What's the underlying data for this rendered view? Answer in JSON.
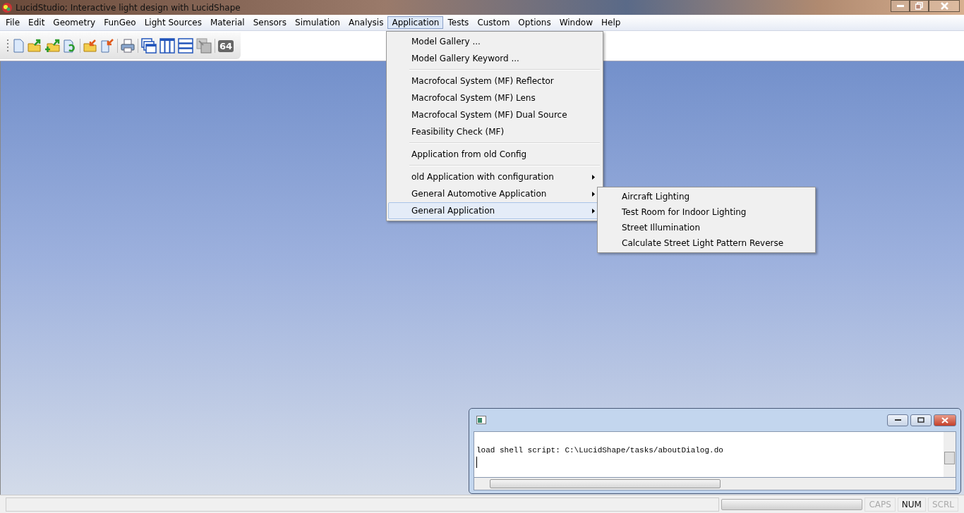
{
  "window": {
    "title": "LucidStudio; Interactive light design with LucidShape"
  },
  "menu_bar": [
    {
      "label": "File",
      "selected": false
    },
    {
      "label": "Edit",
      "selected": false
    },
    {
      "label": "Geometry",
      "selected": false
    },
    {
      "label": "FunGeo",
      "selected": false
    },
    {
      "label": "Light Sources",
      "selected": false
    },
    {
      "label": "Material",
      "selected": false
    },
    {
      "label": "Sensors",
      "selected": false
    },
    {
      "label": "Simulation",
      "selected": false
    },
    {
      "label": "Analysis",
      "selected": false
    },
    {
      "label": "Application",
      "selected": true
    },
    {
      "label": "Tests",
      "selected": false
    },
    {
      "label": "Custom",
      "selected": false
    },
    {
      "label": "Options",
      "selected": false
    },
    {
      "label": "Window",
      "selected": false
    },
    {
      "label": "Help",
      "selected": false
    }
  ],
  "toolbar": {
    "badge": "64"
  },
  "application_menu": {
    "groups": [
      [
        {
          "label": "Model Gallery ...",
          "submenu": false,
          "selected": false
        },
        {
          "label": "Model Gallery Keyword ...",
          "submenu": false,
          "selected": false
        }
      ],
      [
        {
          "label": "Macrofocal System (MF) Reflector",
          "submenu": false,
          "selected": false
        },
        {
          "label": "Macrofocal System (MF) Lens",
          "submenu": false,
          "selected": false
        },
        {
          "label": "Macrofocal System (MF) Dual Source",
          "submenu": false,
          "selected": false
        },
        {
          "label": "Feasibility Check (MF)",
          "submenu": false,
          "selected": false
        }
      ],
      [
        {
          "label": "Application from old Config",
          "submenu": false,
          "selected": false
        }
      ],
      [
        {
          "label": "old Application with configuration",
          "submenu": true,
          "selected": false
        },
        {
          "label": "General Automotive Application",
          "submenu": true,
          "selected": false
        },
        {
          "label": "General Application",
          "submenu": true,
          "selected": true
        }
      ]
    ]
  },
  "submenu": {
    "items": [
      {
        "label": "Aircraft Lighting"
      },
      {
        "label": "Test Room for Indoor Lighting"
      },
      {
        "label": "Street Illumination"
      },
      {
        "label": "Calculate Street Light Pattern Reverse"
      }
    ]
  },
  "console": {
    "lines": [
      "load shell script: C:\\LucidShape/tasks/aboutDialog.do"
    ]
  },
  "status_bar": {
    "progress": {
      "level": 0
    },
    "indicators": [
      {
        "label": "CAPS",
        "on": false
      },
      {
        "label": "NUM",
        "on": true
      },
      {
        "label": "SCRL",
        "on": false
      }
    ]
  }
}
